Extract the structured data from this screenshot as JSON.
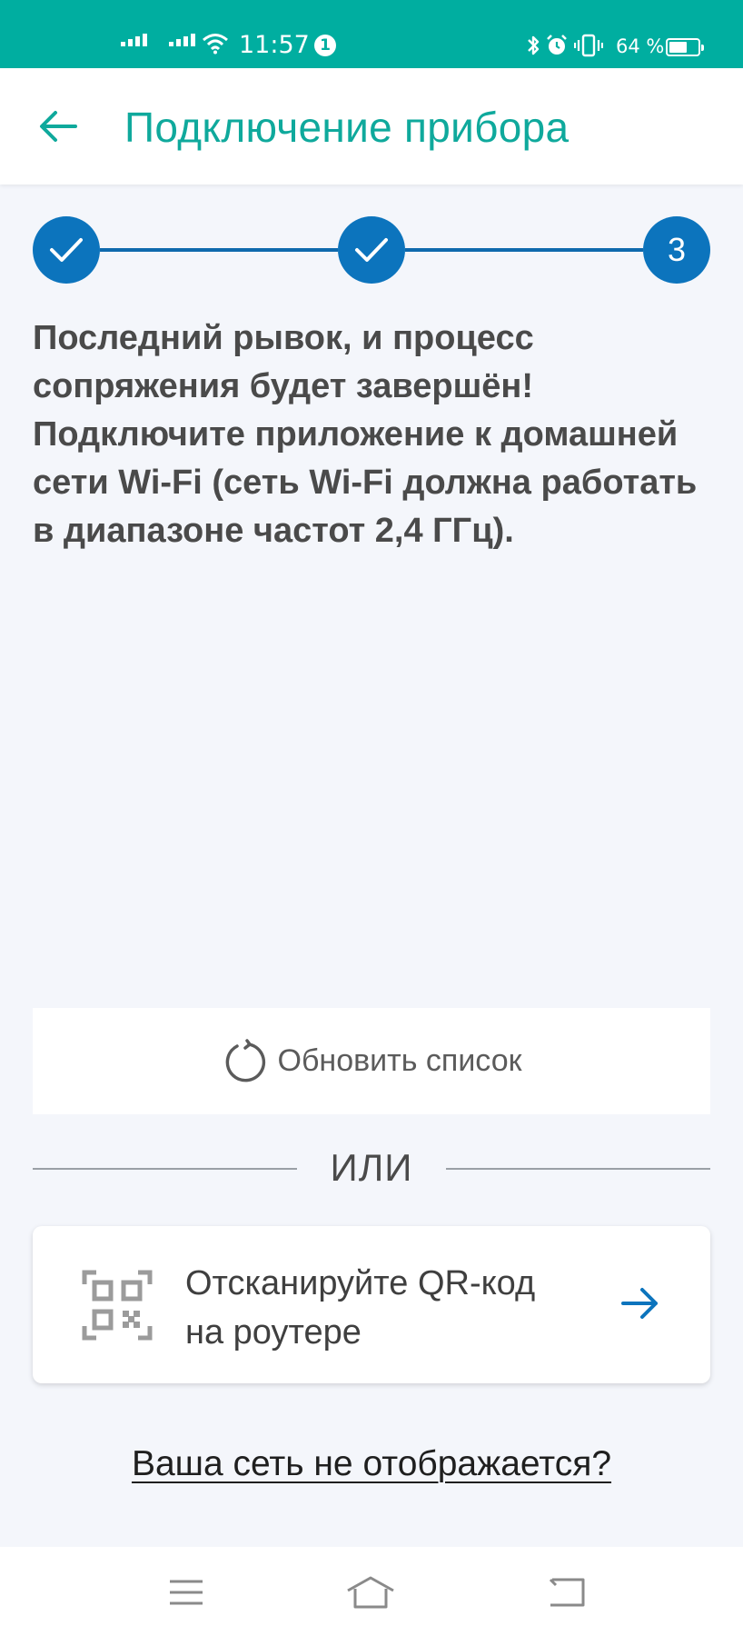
{
  "status_bar": {
    "time": "11:57",
    "notification_badge": "1",
    "battery_percent": "64 %",
    "battery_level": 0.64,
    "icons": [
      "signal-1-icon",
      "signal-2-icon",
      "wifi-icon",
      "bluetooth-icon",
      "alarm-icon",
      "vibrate-icon",
      "battery-icon"
    ],
    "background_color": "#00aea0"
  },
  "header": {
    "back_icon": "arrow-left-icon",
    "title": "Подключение прибора",
    "title_color": "#0fa99c"
  },
  "stepper": {
    "steps": [
      {
        "state": "done",
        "icon": "check-icon",
        "label": ""
      },
      {
        "state": "done",
        "icon": "check-icon",
        "label": ""
      },
      {
        "state": "current",
        "label": "3"
      }
    ],
    "color": "#0c74bd"
  },
  "message": {
    "lines": [
      "Последний рывок, и процесс",
      "сопряжения будет завершён!",
      "Подключите приложение к домашней",
      "сети Wi-Fi (сеть Wi-Fi должна работать",
      "в диапазоне частот 2,4 ГГц)."
    ]
  },
  "refresh": {
    "icon": "refresh-icon",
    "label": "Обновить список"
  },
  "divider": {
    "label": "ИЛИ"
  },
  "qr_card": {
    "icon": "qr-code-icon",
    "line1": "Отсканируйте QR-код",
    "line2": "на роутере",
    "arrow_icon": "arrow-right-icon",
    "arrow_color": "#0c74bd"
  },
  "help_link": {
    "label": "Ваша сеть не отображается?"
  },
  "nav_bar": {
    "items": [
      "menu-icon",
      "home-icon",
      "back-icon"
    ]
  }
}
